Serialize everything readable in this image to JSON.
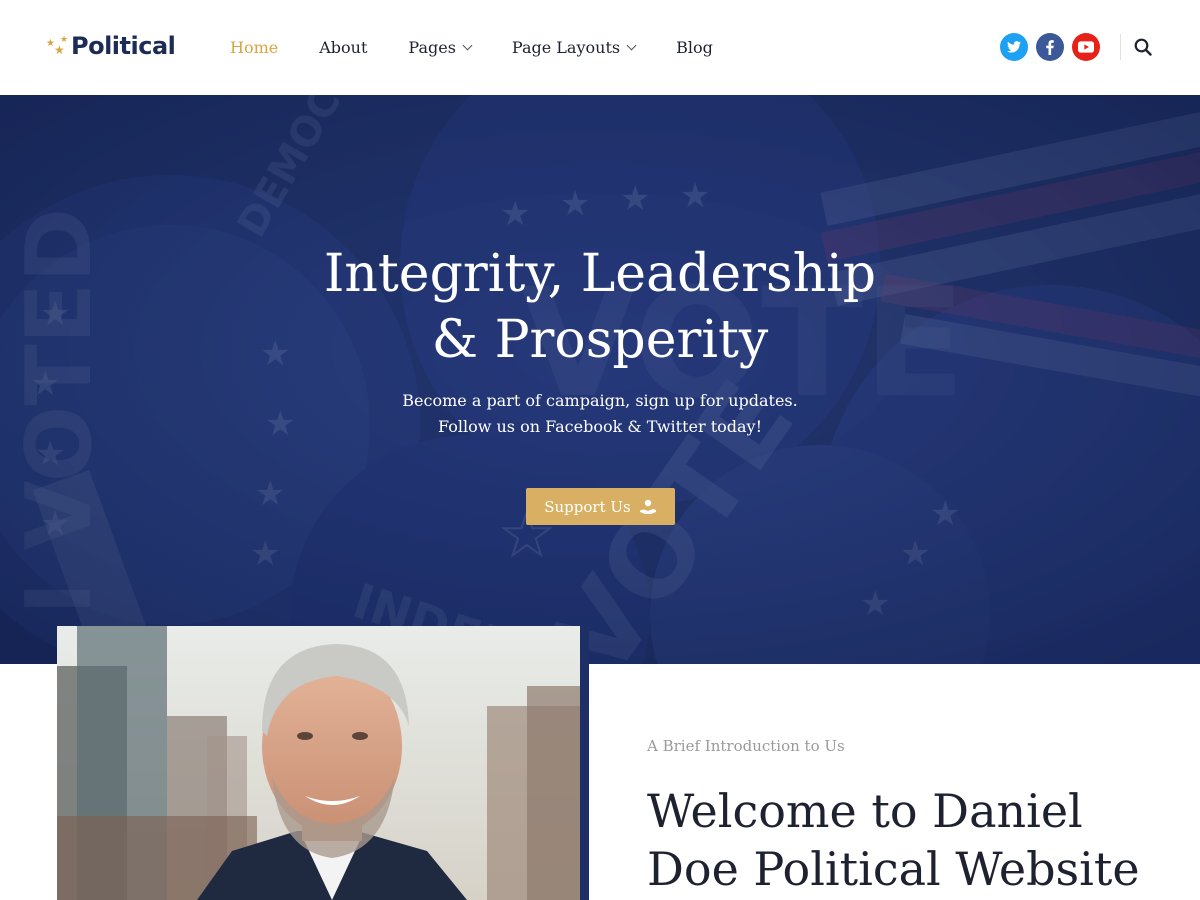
{
  "brand": {
    "name": "Political",
    "accent": "#d9a441",
    "navy": "#1c2c56"
  },
  "nav": {
    "items": [
      {
        "label": "Home",
        "active": true,
        "has_dropdown": false
      },
      {
        "label": "About",
        "active": false,
        "has_dropdown": false
      },
      {
        "label": "Pages",
        "active": false,
        "has_dropdown": true
      },
      {
        "label": "Page Layouts",
        "active": false,
        "has_dropdown": true
      },
      {
        "label": "Blog",
        "active": false,
        "has_dropdown": false
      }
    ]
  },
  "social": [
    {
      "icon": "twitter-icon",
      "color": "#1da1f2"
    },
    {
      "icon": "facebook-icon",
      "color": "#3b5998"
    },
    {
      "icon": "youtube-icon",
      "color": "#e62117"
    }
  ],
  "hero": {
    "title_line1": "Integrity, Leadership",
    "title_line2": "& Prosperity",
    "subtitle_line1": "Become a part of campaign, sign up for updates.",
    "subtitle_line2": "Follow us on Facebook & Twitter today!",
    "button_label": "Support Us",
    "button_color": "#d9b063",
    "background_color": "#1d2f66"
  },
  "about": {
    "label": "A Brief Introduction to Us",
    "title_line1": "Welcome to Daniel",
    "title_line2": "Doe Political Website"
  }
}
